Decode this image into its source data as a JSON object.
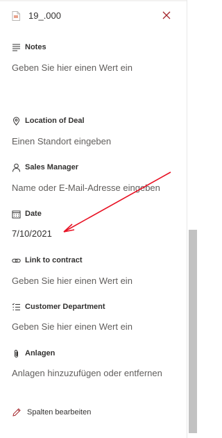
{
  "header": {
    "file_name": "19_.000",
    "file_icon": "document-icon",
    "close_icon": "close-icon"
  },
  "fields": [
    {
      "key": "notes",
      "label": "Notes",
      "icon": "notes-icon",
      "value": "Geben Sie hier einen Wert ein",
      "filled": false
    },
    {
      "key": "location",
      "label": "Location of Deal",
      "icon": "location-pin-icon",
      "value": "Einen Standort eingeben",
      "filled": false
    },
    {
      "key": "sales_manager",
      "label": "Sales Manager",
      "icon": "person-icon",
      "value": "Name oder E-Mail-Adresse eingeben",
      "filled": false
    },
    {
      "key": "date",
      "label": "Date",
      "icon": "calendar-icon",
      "value": "7/10/2021",
      "filled": true
    },
    {
      "key": "link",
      "label": "Link to contract",
      "icon": "link-icon",
      "value": "Geben Sie hier einen Wert ein",
      "filled": false
    },
    {
      "key": "department",
      "label": "Customer Department",
      "icon": "choice-list-icon",
      "value": "Geben Sie hier einen Wert ein",
      "filled": false
    },
    {
      "key": "attachments",
      "label": "Anlagen",
      "icon": "paperclip-icon",
      "value": "Anlagen hinzuzufügen oder entfernen",
      "filled": false
    }
  ],
  "footer": {
    "edit_columns_label": "Spalten bearbeiten",
    "edit_icon": "pencil-icon"
  },
  "colors": {
    "accent_red": "#a4262c",
    "annotation_arrow": "#e81123",
    "placeholder_text": "#605e5c",
    "primary_text": "#323130"
  }
}
